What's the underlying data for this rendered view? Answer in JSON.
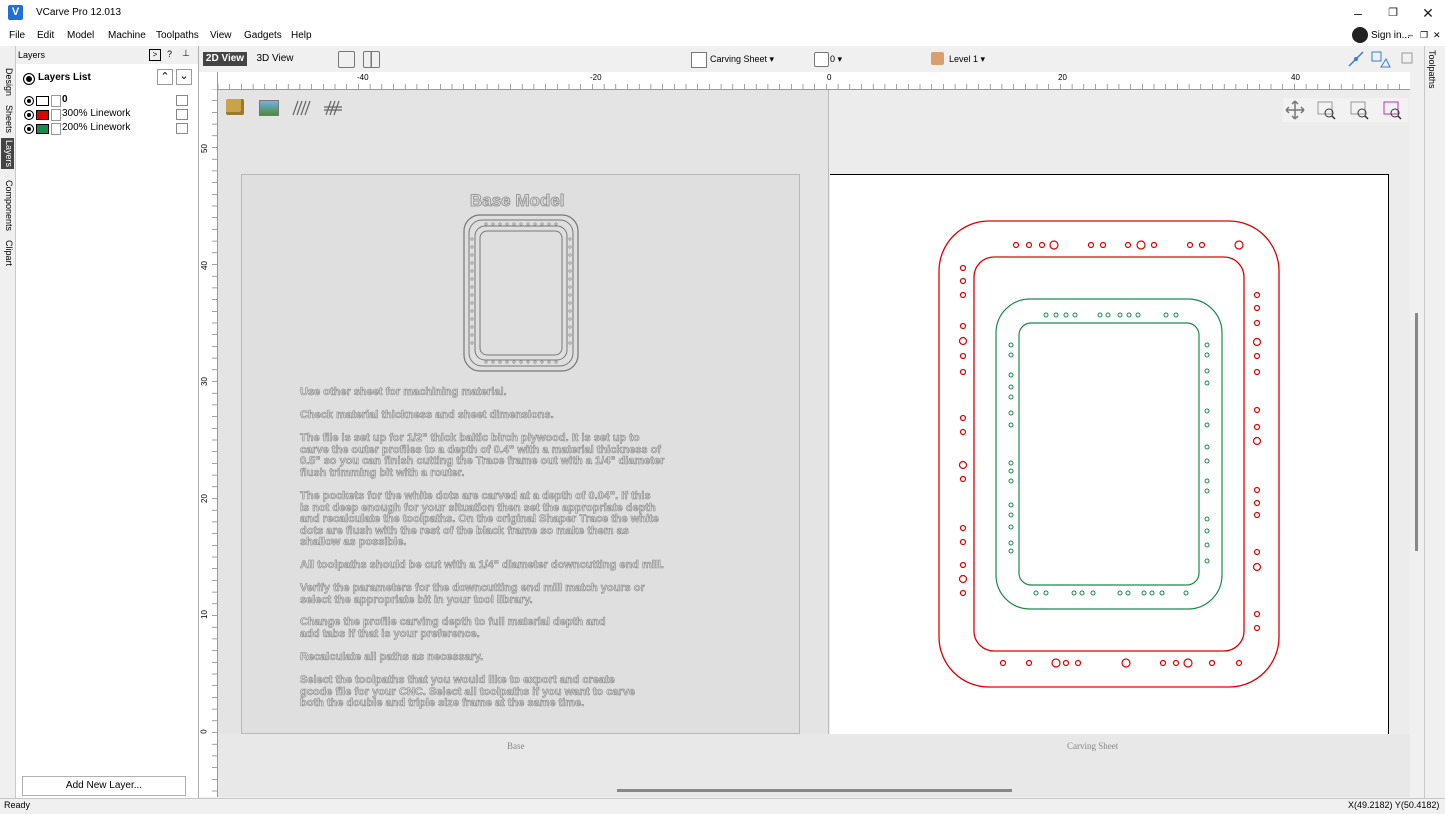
{
  "app": {
    "title": "VCarve Pro 12.013",
    "icon": "V"
  },
  "window_controls": {
    "minimize": "–",
    "restore": "❐",
    "close": "✕"
  },
  "menu": [
    "File",
    "Edit",
    "Model",
    "Machine",
    "Toolpaths",
    "View",
    "Gadgets",
    "Help"
  ],
  "account": {
    "sign_in": "Sign in..."
  },
  "left_tabs": [
    "Design",
    "Sheets",
    "Layers",
    "Components",
    "Clipart"
  ],
  "layers_panel": {
    "header": "Layers",
    "list_title": "Layers List",
    "layers": [
      {
        "name": "0",
        "color": "#000000",
        "bold": true
      },
      {
        "name": "300% Linework",
        "color": "#e00000",
        "bold": false
      },
      {
        "name": "200% Linework",
        "color": "#1a8a4a",
        "bold": false
      }
    ],
    "add_button": "Add New Layer..."
  },
  "view_toolbar": {
    "view_2d": "2D View",
    "view_3d": "3D View",
    "sheet_select": "Carving Sheet",
    "count_select": "0",
    "level_select": "Level 1"
  },
  "right_tabs": {
    "toolpaths": "Toolpaths"
  },
  "ruler": {
    "h_ticks": [
      "-40",
      "-20",
      "0",
      "20",
      "40"
    ],
    "v_ticks": [
      "50",
      "40",
      "30",
      "20",
      "10",
      "0"
    ]
  },
  "base_sheet": {
    "label": "Base",
    "title": "Base Model",
    "notes": [
      "Use other sheet for machining material.",
      "Check material thickness and sheet dimensions.",
      "The file is set up for 1/2\" thick baltic birch plywood.  It is set up to\ncarve the outer profiles to a depth of 0.4\" with a material thickness of\n0.5\" so you can finish cutting the Trace frame out with a 1/4\" diameter\nflush trimming bit with a router.",
      "The pockets for the white dots are carved at a depth of 0.04\".  If this\nis not deep enough for your situation then set the appropriate depth\nand recalculate the toolpaths.  On the original Shaper Trace the white\ndots are flush with the rest of the black frame so make them as\nshallow as possible.",
      "All toolpaths should be cut with a 1/4\" diameter downcutting end mill.",
      "Verify the parameters for the downcutting end mill match yours or\nselect the appropriate bit in your tool library.",
      "Change the profile carving depth to full material depth and\nadd tabs if that is your preference.",
      "Recalculate all paths as necessary.",
      "Select the toolpaths that you would like to export and create\ngcode file for your CNC.  Select all toolpaths if you want to carve\nboth the double and triple size frame at the same time."
    ]
  },
  "carving_sheet": {
    "label": "Carving Sheet"
  },
  "status": {
    "text": "Ready",
    "coords": "X(49.2182) Y(50.4182)"
  },
  "colors": {
    "red_linework": "#e00000",
    "green_linework": "#1a8a4a"
  }
}
